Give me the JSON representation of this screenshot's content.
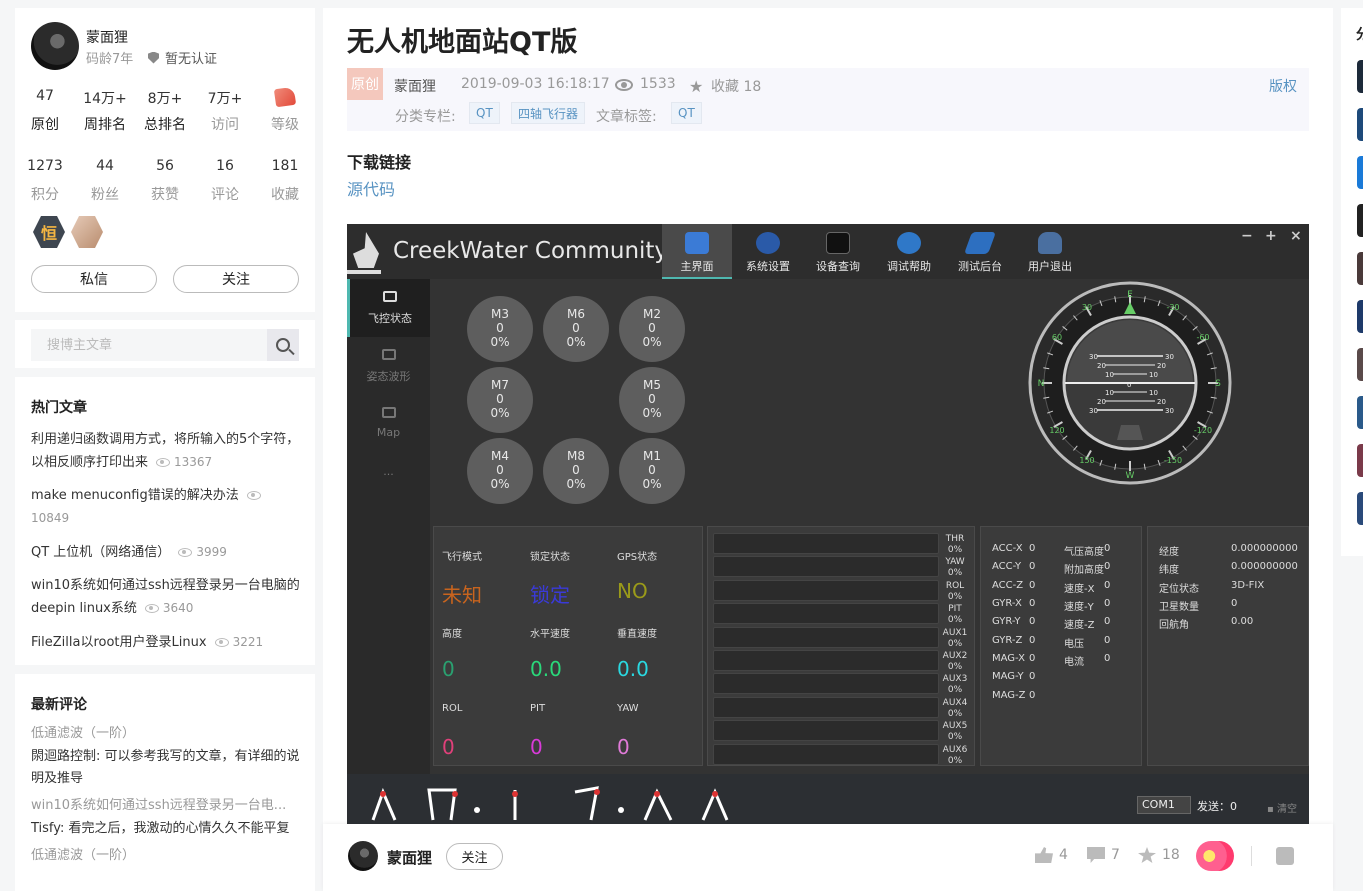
{
  "profile": {
    "name": "蒙面狸",
    "code_age": "码龄7年",
    "cert": "暂无认证",
    "stats1": [
      {
        "value": "47",
        "label": "原创"
      },
      {
        "value": "14万+",
        "label": "周排名"
      },
      {
        "value": "8万+",
        "label": "总排名"
      },
      {
        "value": "7万+",
        "label": "访问"
      },
      {
        "value": "",
        "label": "等级"
      }
    ],
    "stats2": [
      {
        "value": "1273",
        "label": "积分"
      },
      {
        "value": "44",
        "label": "粉丝"
      },
      {
        "value": "56",
        "label": "获赞"
      },
      {
        "value": "16",
        "label": "评论"
      },
      {
        "value": "181",
        "label": "收藏"
      }
    ],
    "badge1_text": "恒",
    "msg_btn": "私信",
    "follow_btn": "关注"
  },
  "search": {
    "placeholder": "搜博主文章"
  },
  "hot": {
    "title": "热门文章",
    "items": [
      {
        "title": "利用递归函数调用方式，将所输入的5个字符，以相反顺序打印出来",
        "views": "13367"
      },
      {
        "title": "make menuconfig错误的解决办法",
        "views": "10849"
      },
      {
        "title": "QT 上位机（网络通信）",
        "views": "3999"
      },
      {
        "title": "win10系统如何通过ssh远程登录另一台电脑的deepin linux系统",
        "views": "3640"
      },
      {
        "title": "FileZilla以root用户登录Linux",
        "views": "3221"
      }
    ]
  },
  "comments": {
    "title": "最新评论",
    "items": [
      {
        "article": "低通滤波（一阶）",
        "text": "閖迴路控制: 可以参考我写的文章，有详细的说明及推导"
      },
      {
        "article": "win10系统如何通过ssh远程登录另一台电...",
        "text": "Tisfy: 看完之后，我激动的心情久久不能平复"
      },
      {
        "article": "低通滤波（一阶）",
        "text": ""
      }
    ]
  },
  "article": {
    "title": "无人机地面站QT版",
    "original_tag": "原创",
    "author": "蒙面狸",
    "date": "2019-09-03 16:18:17",
    "views": "1533",
    "fav": "收藏 18",
    "copyright": "版权",
    "category_label": "分类专栏:",
    "categories": [
      "QT",
      "四轴飞行器"
    ],
    "tag_label": "文章标签:",
    "tags": [
      "QT"
    ],
    "download_heading": "下载链接",
    "download_link": "源代码"
  },
  "app": {
    "name": "CreekWater Community",
    "tabs": [
      {
        "label": "主界面",
        "color": "#3b7bd6"
      },
      {
        "label": "系统设置",
        "color": "#2a5aa8"
      },
      {
        "label": "设备查询",
        "color": "#222222"
      },
      {
        "label": "调试帮助",
        "color": "#2f78c8"
      },
      {
        "label": "测试后台",
        "color": "#2d6fc0"
      },
      {
        "label": "用户退出",
        "color": "#4a6fa0"
      }
    ],
    "window_controls": [
      "−",
      "+",
      "×"
    ],
    "side": [
      {
        "label": "飞控状态"
      },
      {
        "label": "姿态波形"
      },
      {
        "label": "Map"
      },
      {
        "label": "..."
      }
    ],
    "motors": [
      {
        "name": "M3",
        "value": "0",
        "percent": "0%"
      },
      {
        "name": "M6",
        "value": "0",
        "percent": "0%"
      },
      {
        "name": "M2",
        "value": "0",
        "percent": "0%"
      },
      {
        "name": "M7",
        "value": "0",
        "percent": "0%"
      },
      {
        "name": "M5",
        "value": "0",
        "percent": "0%"
      },
      {
        "name": "M4",
        "value": "0",
        "percent": "0%"
      },
      {
        "name": "M8",
        "value": "0",
        "percent": "0%"
      },
      {
        "name": "M1",
        "value": "0",
        "percent": "0%"
      }
    ],
    "compass": {
      "marks": [
        "E",
        "S",
        "W",
        "N",
        "30",
        "60",
        "120",
        "150",
        "-30",
        "-60",
        "-120",
        "-150"
      ],
      "pitch": [
        "30",
        "20",
        "10",
        "0",
        "10",
        "20",
        "30"
      ]
    },
    "flight": [
      {
        "label": "飞行模式",
        "value": "未知",
        "color": "#c8641e"
      },
      {
        "label": "锁定状态",
        "value": "锁定",
        "color": "#3a3ad8"
      },
      {
        "label": "GPS状态",
        "value": "NO",
        "color": "#9a9a1a"
      },
      {
        "label": "高度",
        "value": "0",
        "color": "#2aa070"
      },
      {
        "label": "水平速度",
        "value": "0.0",
        "color": "#2ad87a"
      },
      {
        "label": "垂直速度",
        "value": "0.0",
        "color": "#2ad8e0"
      },
      {
        "label": "ROL",
        "value": "0",
        "color": "#e0407a"
      },
      {
        "label": "PIT",
        "value": "0",
        "color": "#d83ad8"
      },
      {
        "label": "YAW",
        "value": "0",
        "color": "#e07ad8"
      }
    ],
    "channels": [
      {
        "name": "THR",
        "percent": "0%"
      },
      {
        "name": "YAW",
        "percent": "0%"
      },
      {
        "name": "ROL",
        "percent": "0%"
      },
      {
        "name": "PIT",
        "percent": "0%"
      },
      {
        "name": "AUX1",
        "percent": "0%"
      },
      {
        "name": "AUX2",
        "percent": "0%"
      },
      {
        "name": "AUX3",
        "percent": "0%"
      },
      {
        "name": "AUX4",
        "percent": "0%"
      },
      {
        "name": "AUX5",
        "percent": "0%"
      },
      {
        "name": "AUX6",
        "percent": "0%"
      }
    ],
    "sensors_a": [
      {
        "label": "ACC-X",
        "value": "0"
      },
      {
        "label": "ACC-Y",
        "value": "0"
      },
      {
        "label": "ACC-Z",
        "value": "0"
      },
      {
        "label": "GYR-X",
        "value": "0"
      },
      {
        "label": "GYR-Y",
        "value": "0"
      },
      {
        "label": "GYR-Z",
        "value": "0"
      },
      {
        "label": "MAG-X",
        "value": "0"
      },
      {
        "label": "MAG-Y",
        "value": "0"
      },
      {
        "label": "MAG-Z",
        "value": "0"
      }
    ],
    "sensors_b": [
      {
        "label": "气压高度",
        "value": "0"
      },
      {
        "label": "附加高度",
        "value": "0"
      },
      {
        "label": "速度-X",
        "value": "0"
      },
      {
        "label": "速度-Y",
        "value": "0"
      },
      {
        "label": "速度-Z",
        "value": "0"
      },
      {
        "label": "电压",
        "value": "0"
      },
      {
        "label": "电流",
        "value": "0"
      }
    ],
    "gps": [
      {
        "label": "经度",
        "value": "0.000000000"
      },
      {
        "label": "纬度",
        "value": "0.000000000"
      },
      {
        "label": "定位状态",
        "value": "3D-FIX"
      },
      {
        "label": "卫星数量",
        "value": "0"
      },
      {
        "label": "回航角",
        "value": "0.00"
      }
    ],
    "port": "COM1",
    "send": "发送：0",
    "clear": "清空"
  },
  "footer": {
    "author": "蒙面狸",
    "follow": "关注",
    "likes": "4",
    "comments": "7",
    "favorites": "18"
  },
  "right": {
    "title_partial": "分"
  },
  "colors": {
    "link": "#5893c2",
    "accent": "#4fb8b0",
    "original_tag": "#f4c8bd"
  }
}
